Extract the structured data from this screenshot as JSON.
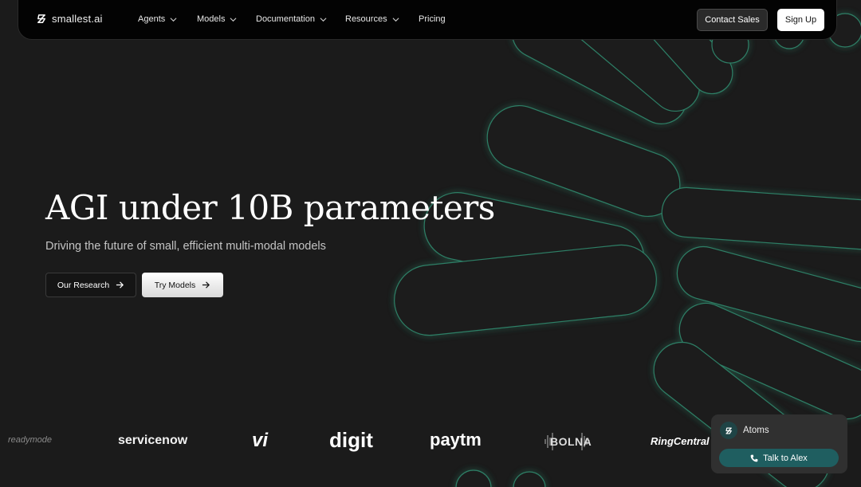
{
  "brand": {
    "name": "smallest.ai",
    "icon": "smallest-logo-icon"
  },
  "nav": {
    "items": [
      {
        "label": "Agents",
        "has_dropdown": true
      },
      {
        "label": "Models",
        "has_dropdown": true
      },
      {
        "label": "Documentation",
        "has_dropdown": true
      },
      {
        "label": "Resources",
        "has_dropdown": true
      },
      {
        "label": "Pricing",
        "has_dropdown": false
      }
    ],
    "contact_sales": "Contact Sales",
    "sign_up": "Sign Up"
  },
  "hero": {
    "title": "AGI under 10B parameters",
    "subtitle": "Driving the future of small, efficient multi-modal models",
    "research_button": "Our Research",
    "try_button": "Try Models"
  },
  "customers": [
    "readymode",
    "servicenow",
    "vi",
    "digit",
    "paytm",
    "BOLNA",
    "RingCentral"
  ],
  "chat_widget": {
    "agent_name": "Atoms",
    "call_button": "Talk to Alex",
    "icon": "phone-icon"
  },
  "colors": {
    "background": "#1b1b1b",
    "nav": "#030303",
    "accent": "#1f5e60",
    "outline": "#2fae86"
  }
}
